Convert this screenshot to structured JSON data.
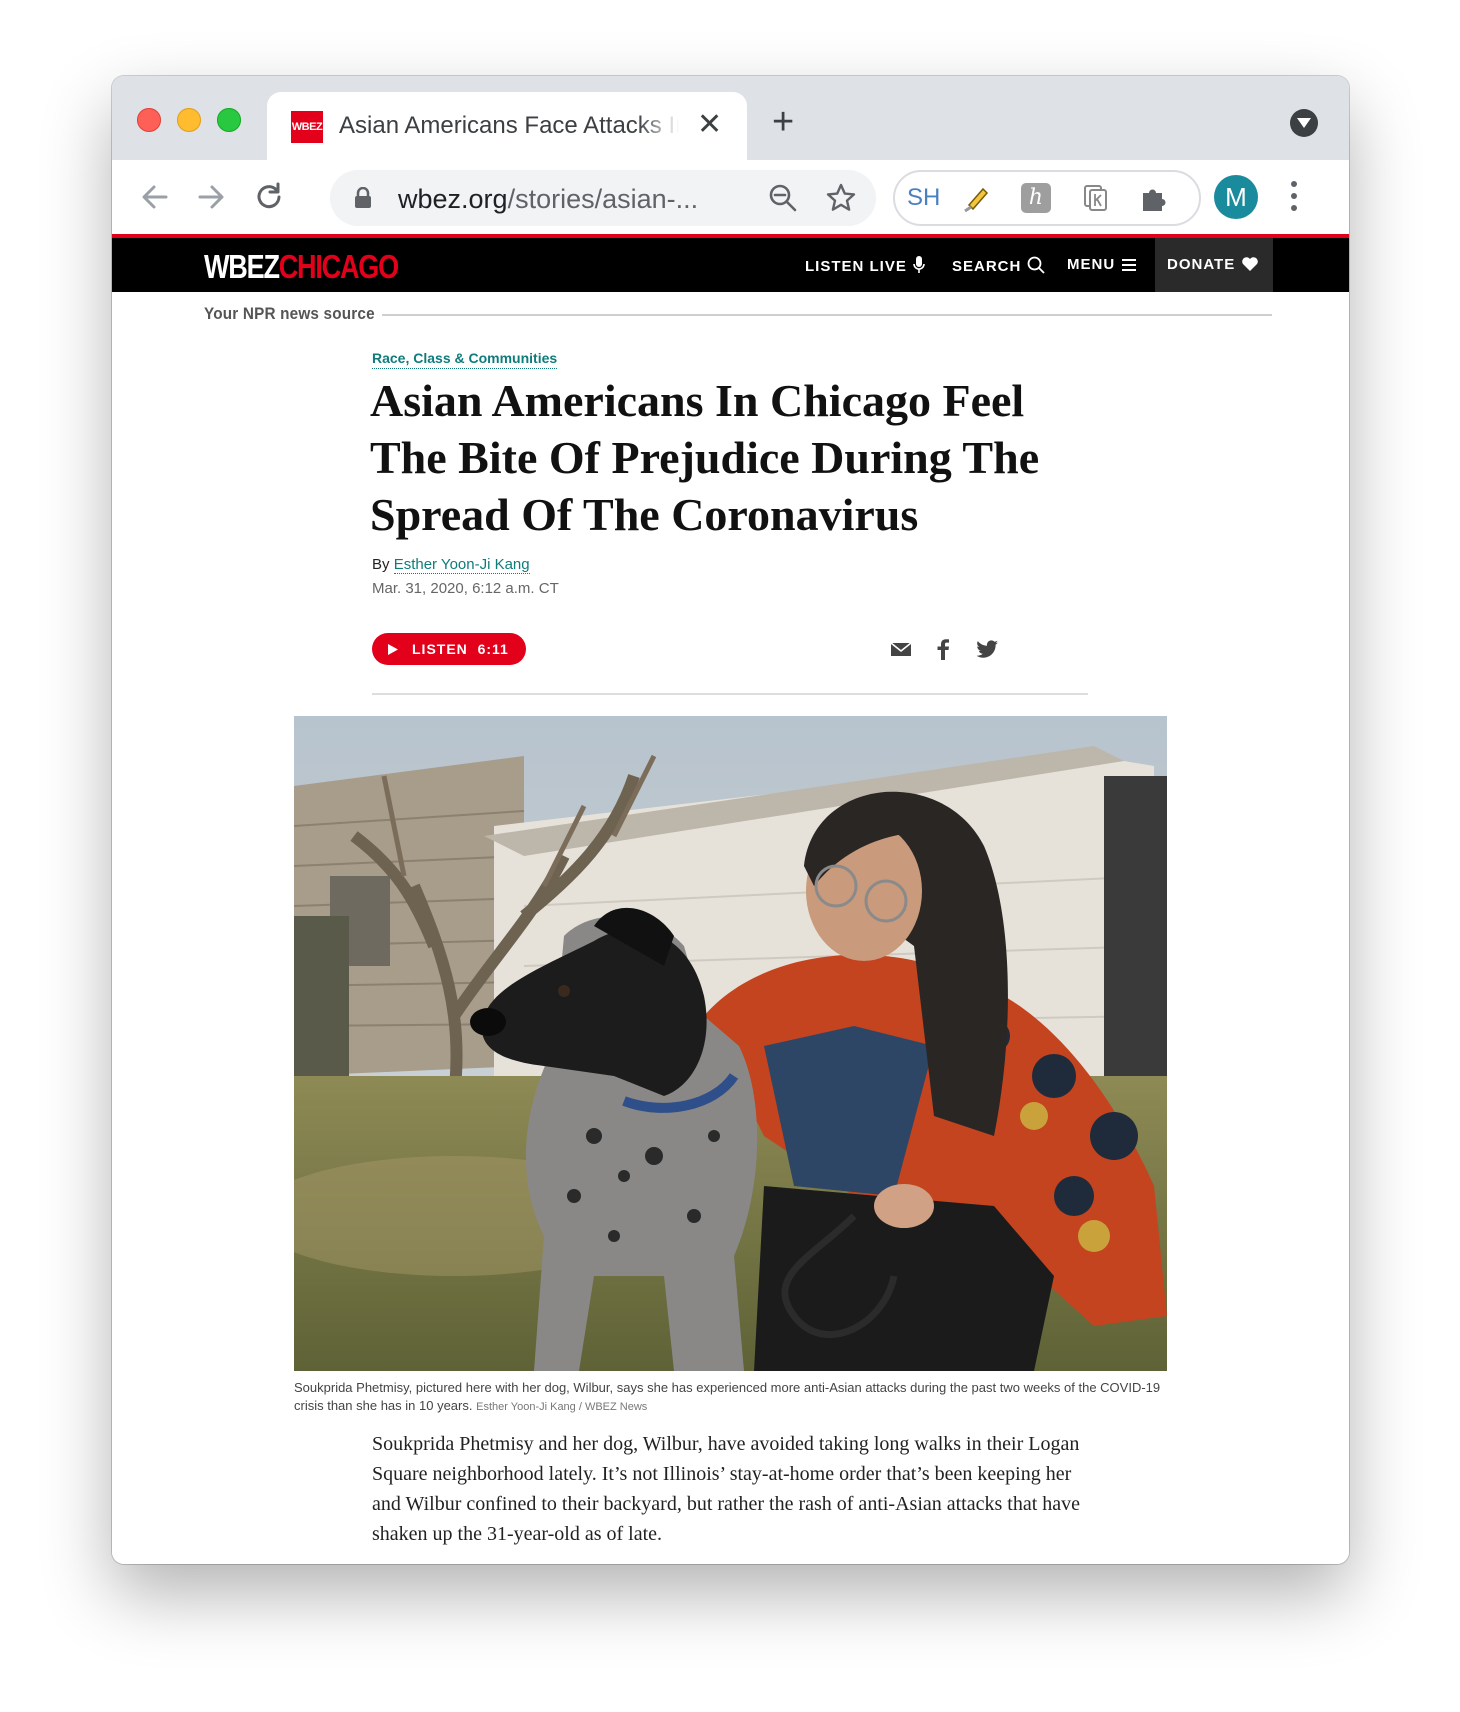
{
  "browser": {
    "tab": {
      "favicon_text": "WBEZ",
      "title": "Asian Americans Face Attacks In Chicago | WBEZ"
    },
    "address": {
      "domain": "wbez.org",
      "path": "/stories/asian-..."
    },
    "extensions": {
      "sh_label": "SH"
    },
    "profile_initial": "M"
  },
  "site": {
    "logo_main": "WBEZ",
    "logo_accent": "CHICAGO",
    "tagline": "Your NPR news source",
    "nav": {
      "listen_live": "LISTEN LIVE",
      "search": "SEARCH",
      "menu": "MENU",
      "donate": "DONATE"
    }
  },
  "article": {
    "category": "Race, Class & Communities",
    "headline": "Asian Americans In Chicago Feel The Bite Of Prejudice During The Spread Of The Coronavirus",
    "byline_prefix": "By",
    "author": "Esther Yoon-Ji Kang",
    "date": "Mar. 31, 2020, 6:12 a.m. CT",
    "listen_label": "LISTEN",
    "listen_duration": "6:11",
    "caption": "Soukprida Phetmisy, pictured here with her dog, Wilbur, says she has experienced more anti-Asian attacks during the past two weeks of the COVID-19 crisis than she has in 10 years.",
    "credit": "Esther Yoon-Ji Kang / WBEZ News",
    "body": "Soukprida Phetmisy and her dog, Wilbur, have avoided taking long walks in their Logan Square neighborhood lately. It’s not Illinois’ stay-at-home order that’s been keeping her and Wilbur confined to their backyard, but rather the rash of anti-Asian attacks that have shaken up the 31-year-old as of late."
  },
  "colors": {
    "brand_red": "#e3001b",
    "link_teal": "#0e7c7b",
    "nav_black": "#000000"
  },
  "icons": [
    "back-arrow-icon",
    "forward-arrow-icon",
    "reload-icon",
    "lock-icon",
    "zoom-out-icon",
    "star-icon",
    "highlighter-icon",
    "h-extension-icon",
    "k-extension-icon",
    "puzzle-icon",
    "kebab-menu-icon",
    "microphone-icon",
    "search-icon",
    "menu-icon",
    "heart-icon",
    "play-icon",
    "email-icon",
    "facebook-icon",
    "twitter-icon"
  ]
}
